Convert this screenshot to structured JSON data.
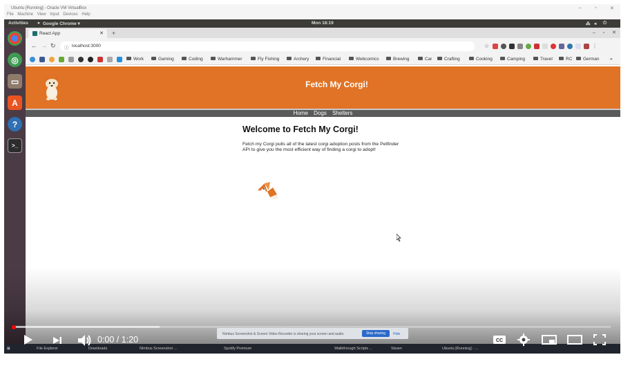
{
  "vbox": {
    "title": "Ubuntu [Running] - Oracle VM VirtualBox",
    "menu": [
      "File",
      "Machine",
      "View",
      "Input",
      "Devices",
      "Help"
    ]
  },
  "ubuntu_bar": {
    "activities": "Activities",
    "app": "Google Chrome ▾",
    "clock": "Mon 18:19"
  },
  "browser": {
    "tab_title": "React App",
    "url": "localhost:3000",
    "bookmarks": [
      "Work",
      "Gaming",
      "Coding",
      "Warhammer",
      "Fly Fishing",
      "Archery",
      "Financial",
      "Webcomics",
      "Brewing",
      "Car",
      "Crafting",
      "Cooking",
      "Camping",
      "Travel",
      "RC",
      "German"
    ]
  },
  "app": {
    "title": "Fetch My Corgi!",
    "nav": [
      "Home",
      "Dogs",
      "Shelters"
    ],
    "welcome": "Welcome to Fetch My Corgi!",
    "intro": "Fetch my Corgi pulls all of the latest corgi adoption posts from the Petfinder API to give you the most efficient way of finding a corgi to adopt!"
  },
  "player": {
    "time": "0:00 / 1:20",
    "progress": 0,
    "cc": "CC"
  },
  "screen_share": {
    "message": "Nimbus Screenshot & Screen Video Recorder is sharing your screen and audio.",
    "stop": "Stop sharing",
    "hide": "Hide"
  },
  "taskbar": [
    "File Explorer",
    "Downloads",
    "Nimbus Screenshot ...",
    "Spotify Premium",
    "Walkthrough Scripts ...",
    "Steam",
    "Ubuntu [Running] - ..."
  ],
  "colors": {
    "header": "#e07325",
    "nav": "#5a5a5a",
    "launcher": "#4b3b45"
  }
}
